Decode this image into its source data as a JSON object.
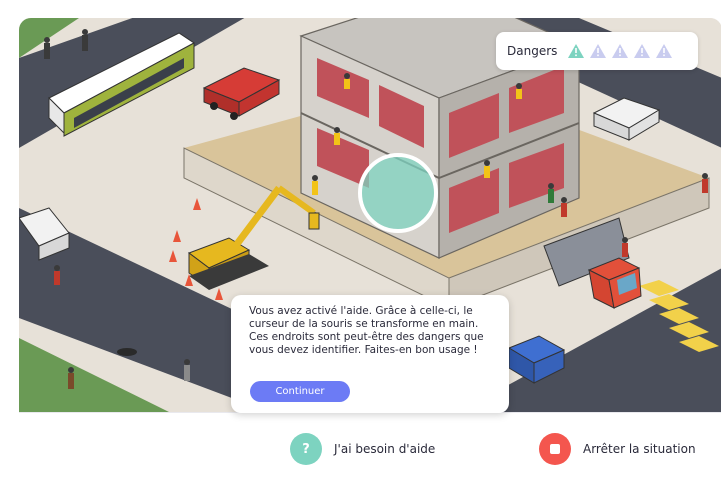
{
  "dangers": {
    "label": "Dangers",
    "total": 5,
    "found": 1,
    "found_color": "#7dd3c0",
    "pending_color": "#c9ccef"
  },
  "dialog": {
    "text": "Vous avez activé l'aide. Grâce à celle-ci, le curseur de la souris se transforme en main. Ces endroits sont peut-être des dangers que vous devez identifier. Faites-en bon usage !",
    "continue_label": "Continuer",
    "accent": "#6c7bf5"
  },
  "footer": {
    "help_icon": "?",
    "help_label": "J'ai besoin d'aide",
    "stop_label": "Arrêter la situation",
    "help_color": "#7dd3c0",
    "stop_color": "#f4564e"
  },
  "scene": {
    "icons": [
      "construction-site",
      "excavator",
      "bus",
      "red-car",
      "white-car",
      "blue-car",
      "red-truck",
      "traffic-cones",
      "workers",
      "pedestrians",
      "crosswalk",
      "help-highlight-circle"
    ]
  }
}
